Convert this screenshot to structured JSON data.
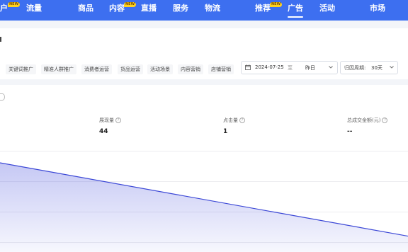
{
  "nav": {
    "items": [
      {
        "label": "户",
        "badge": "NEW"
      },
      {
        "label": "流量",
        "badge": ""
      },
      {
        "label": "商品",
        "badge": ""
      },
      {
        "label": "内容",
        "badge": "NEW"
      },
      {
        "label": "直播",
        "badge": ""
      },
      {
        "label": "服务",
        "badge": ""
      },
      {
        "label": "物流",
        "badge": ""
      },
      {
        "label": "推荐",
        "badge": "NEW"
      },
      {
        "label": "广告",
        "badge": "",
        "active": true
      },
      {
        "label": "活动",
        "badge": ""
      },
      {
        "label": "市场",
        "badge": ""
      }
    ]
  },
  "filters": {
    "tabs": [
      "关键词推广",
      "精准人群推广",
      "消费者运营",
      "货品运营",
      "活动场景",
      "内容营销",
      "店铺营销"
    ],
    "date": "2024-07-25",
    "date_sep": "至",
    "date_preset": "昨日",
    "period_label": "归因周期:",
    "period_value": "30天"
  },
  "metrics": [
    {
      "label": "展现量",
      "value": "44"
    },
    {
      "label": "点击量",
      "value": "1"
    },
    {
      "label": "总成交金额(元)",
      "value": "--"
    }
  ],
  "chart_data": {
    "type": "area",
    "series": [
      {
        "values": [
          44,
          1
        ]
      }
    ],
    "color": "#3b47d6",
    "grid": true
  },
  "colors": {
    "nav_bg": "#3d6ff0",
    "accent": "#3b47d6",
    "badge": "#ffd21e"
  }
}
